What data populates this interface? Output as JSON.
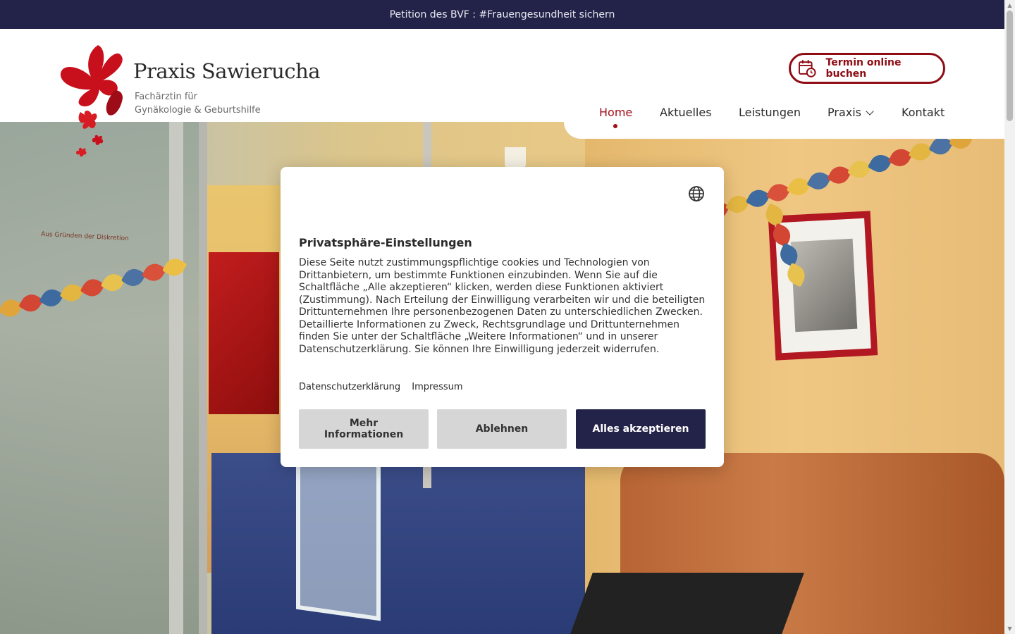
{
  "topbar": {
    "text": "Petition des BVF : #Frauengesundheit sichern"
  },
  "logo": {
    "title": "Praxis Sawierucha",
    "subtitle_line1": "Fachärztin für",
    "subtitle_line2": "Gynäkologie & Geburtshilfe",
    "icon": "butterfly-logo-icon",
    "color": "#c8101c"
  },
  "header": {
    "book_button": "Termin online buchen",
    "book_icon": "calendar-clock-icon",
    "accent": "#8e0c14"
  },
  "nav": {
    "items": [
      {
        "label": "Home",
        "active": true
      },
      {
        "label": "Aktuelles",
        "active": false
      },
      {
        "label": "Leistungen",
        "active": false
      },
      {
        "label": "Praxis",
        "active": false,
        "dropdown": true
      },
      {
        "label": "Kontakt",
        "active": false
      }
    ]
  },
  "hero": {
    "image": "waiting-room-photo",
    "etched_text": "Aus Gründen der Diskretion"
  },
  "cookie_modal": {
    "language_icon": "globe-icon",
    "title": "Privatsphäre-Einstellungen",
    "body": "Diese Seite nutzt zustimmungspflichtige cookies und Technologien von Drittanbietern, um bestimmte Funktionen einzubinden. Wenn Sie auf die Schaltfläche „Alle akzeptieren“ klicken, werden diese Funktionen aktiviert (Zustimmung). Nach Erteilung der Einwilligung verarbeiten wir und die beteiligten Drittunternehmen Ihre personenbezogenen Daten zu unterschiedlichen Zwecken. Detaillierte Informationen zu Zweck, Rechtsgrundlage und Drittunternehmen finden Sie unter der Schaltfläche „Weitere Informationen“ und in unserer Datenschutzerklärung. Sie können Ihre Einwilligung jederzeit widerrufen.",
    "links": [
      "Datenschutzerklärung",
      "Impressum"
    ],
    "buttons": {
      "more": "Mehr Informationen",
      "decline": "Ablehnen",
      "accept": "Alles akzeptieren"
    },
    "accept_color": "#23234a"
  }
}
